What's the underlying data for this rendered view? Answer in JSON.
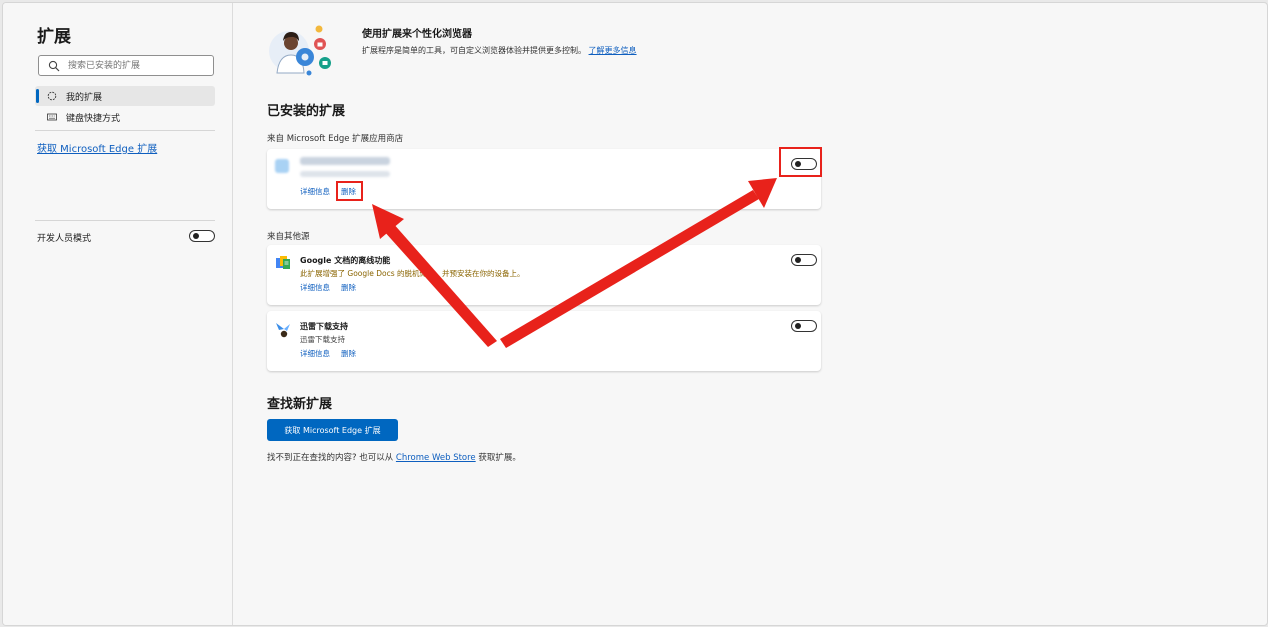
{
  "sidebar": {
    "title": "扩展",
    "search_placeholder": "搜索已安装的扩展",
    "nav": [
      {
        "label": "我的扩展",
        "icon": "gear-outline-icon"
      },
      {
        "label": "键盘快捷方式",
        "icon": "keyboard-icon"
      }
    ],
    "get_extensions_link": "获取 Microsoft Edge 扩展",
    "dev_mode_label": "开发人员模式",
    "dev_mode_on": false
  },
  "hero": {
    "title": "使用扩展来个性化浏览器",
    "subtitle": "扩展程序是简单的工具，可自定义浏览器体验并提供更多控制。",
    "learn_more": "了解更多信息"
  },
  "installed": {
    "heading": "已安装的扩展",
    "store_section_label": "来自 Microsoft Edge 扩展应用商店",
    "other_section_label": "来自其他源",
    "store_items": [
      {
        "name": "",
        "description": "",
        "details_label": "详细信息",
        "remove_label": "删除",
        "enabled": false,
        "blurred": true
      }
    ],
    "other_items": [
      {
        "name": "Google 文档的离线功能",
        "description": "此扩展增强了 Google Docs 的脱机体验，并预安装在你的设备上。",
        "details_label": "详细信息",
        "remove_label": "删除",
        "enabled": false,
        "icon": "google-docs-offline-icon"
      },
      {
        "name": "迅雷下载支持",
        "description": "迅雷下载支持",
        "details_label": "详细信息",
        "remove_label": "删除",
        "enabled": false,
        "icon": "xunlei-bird-icon"
      }
    ]
  },
  "find_new": {
    "heading": "查找新扩展",
    "button_label": "获取 Microsoft Edge 扩展",
    "footer_prefix": "找不到正在查找的内容? 也可以从",
    "footer_link": "Chrome Web Store",
    "footer_suffix": "获取扩展。"
  },
  "colors": {
    "accent": "#0067c0",
    "annotation": "#e8221b"
  }
}
